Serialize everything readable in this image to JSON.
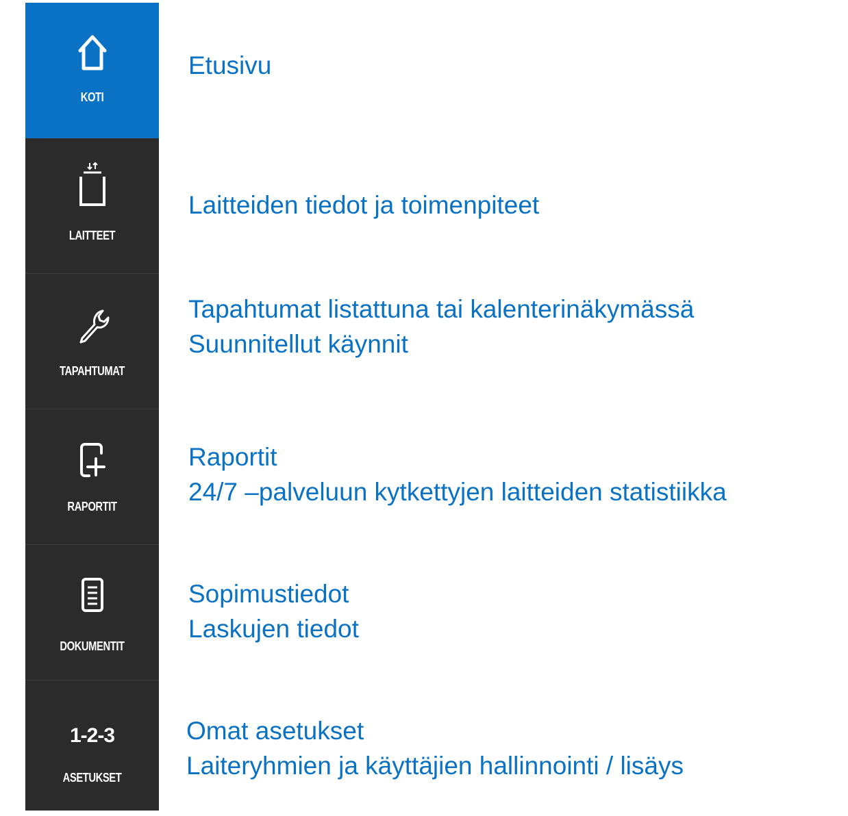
{
  "nav": {
    "items": [
      {
        "label": "KOTI",
        "icon": "home-icon",
        "active": true
      },
      {
        "label": "LAITTEET",
        "icon": "device-icon",
        "active": false
      },
      {
        "label": "TAPAHTUMAT",
        "icon": "wrench-icon",
        "active": false
      },
      {
        "label": "RAPORTIT",
        "icon": "report-add-icon",
        "active": false
      },
      {
        "label": "DOKUMENTIT",
        "icon": "document-icon",
        "active": false
      },
      {
        "label": "ASETUKSET",
        "icon": "1-2-3",
        "active": false
      }
    ]
  },
  "descriptions": {
    "koti": [
      "Etusivu"
    ],
    "laitteet": [
      "Laitteiden tiedot ja toimenpiteet"
    ],
    "tapahtumat": [
      "Tapahtumat listattuna tai kalenterinäkymässä",
      "Suunnitellut käynnit"
    ],
    "raportit": [
      "Raportit",
      "24/7 –palveluun kytkettyjen laitteiden statistiikka"
    ],
    "dokumentit": [
      "Sopimustiedot",
      "Laskujen tiedot"
    ],
    "asetukset": [
      "Omat asetukset",
      "Laiteryhmien ja käyttäjien hallinnointi / lisäys"
    ]
  },
  "colors": {
    "accent": "#0a72c4",
    "sidebar": "#2b2b2b",
    "text": "#0a72c4"
  }
}
